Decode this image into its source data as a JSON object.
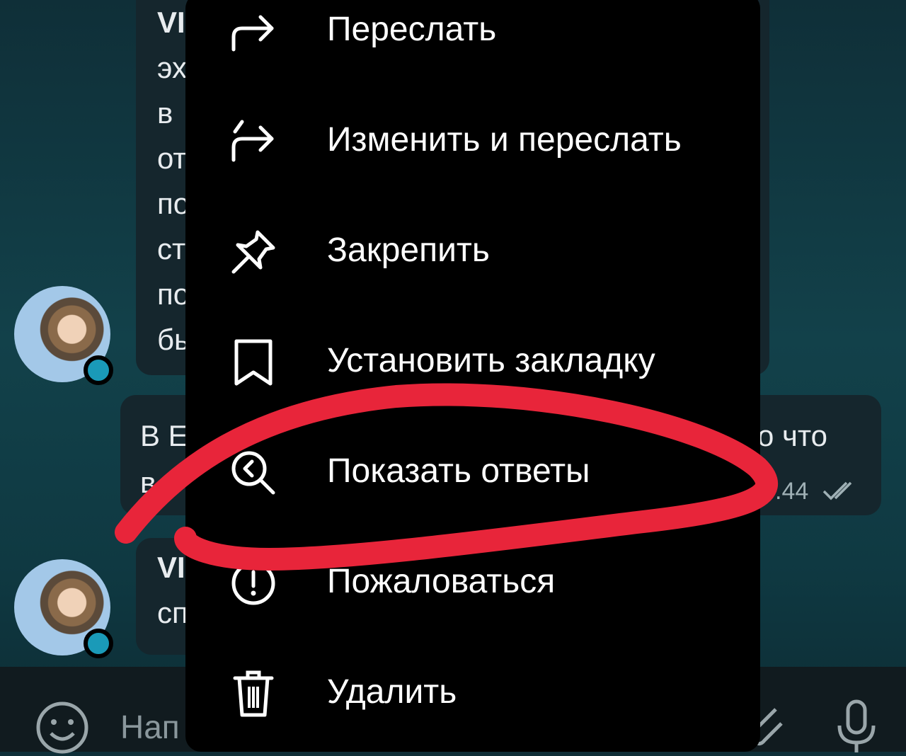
{
  "chat": {
    "message1_lines": [
      "VI",
      "эх",
      "в",
      "от",
      "по",
      "ст",
      "по",
      "бы"
    ],
    "message2_left": "В Е",
    "message2_second_left": "в",
    "message2_right": "о что",
    "message2_time": ".44",
    "message3_lines": [
      "VI",
      "сп"
    ]
  },
  "composer": {
    "placeholder": "Нап"
  },
  "context_menu": {
    "items": [
      {
        "label": "Переслать",
        "icon": "forward-icon"
      },
      {
        "label": "Изменить и переслать",
        "icon": "edit-forward-icon"
      },
      {
        "label": "Закрепить",
        "icon": "pin-icon"
      },
      {
        "label": "Установить закладку",
        "icon": "bookmark-icon"
      },
      {
        "label": "Показать ответы",
        "icon": "search-replies-icon"
      },
      {
        "label": "Пожаловаться",
        "icon": "report-icon"
      },
      {
        "label": "Удалить",
        "icon": "trash-icon"
      }
    ]
  },
  "colors": {
    "annotation": "#e8253a",
    "online_dot": "#1a9ab8",
    "menu_background": "#000000"
  }
}
